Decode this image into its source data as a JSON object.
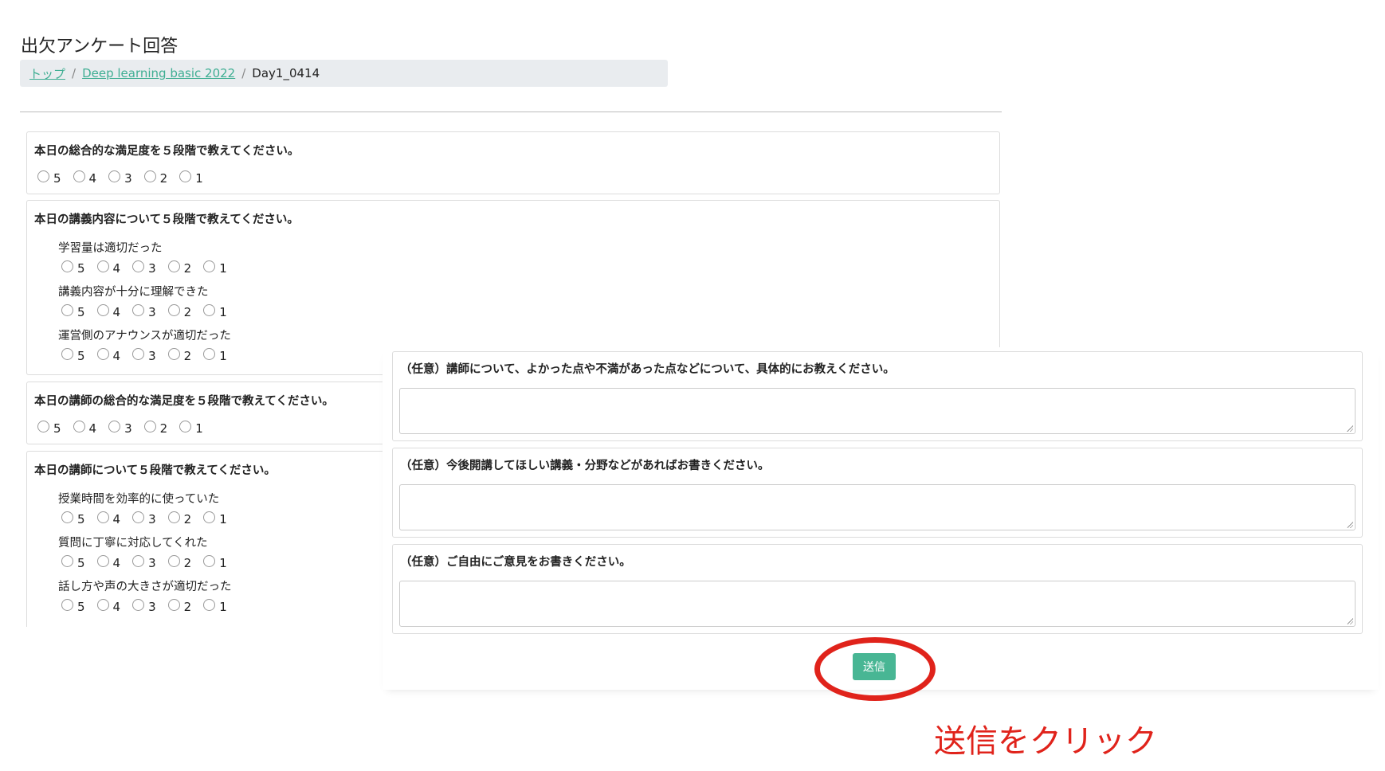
{
  "page": {
    "title": "出欠アンケート回答"
  },
  "breadcrumb": {
    "home": "トップ",
    "course": "Deep learning basic 2022",
    "current": "Day1_0414",
    "separator": "/"
  },
  "scale": [
    "5",
    "4",
    "3",
    "2",
    "1"
  ],
  "questions": {
    "q1": {
      "title": "本日の総合的な満足度を５段階で教えてください。"
    },
    "q2": {
      "title": "本日の講義内容について５段階で教えてください。",
      "items": [
        "学習量は適切だった",
        "講義内容が十分に理解できた",
        "運営側のアナウンスが適切だった"
      ]
    },
    "q3": {
      "title": "本日の講師の総合的な満足度を５段階で教えてください。"
    },
    "q4": {
      "title": "本日の講師について５段階で教えてください。",
      "items": [
        "授業時間を効率的に使っていた",
        "質問に丁寧に対応してくれた",
        "話し方や声の大きさが適切だった"
      ]
    }
  },
  "free": {
    "q5": {
      "title": "（任意）講師について、よかった点や不満があった点などについて、具体的にお教えください。",
      "value": ""
    },
    "q6": {
      "title": "（任意）今後開講してほしい講義・分野などがあればお書きください。",
      "value": ""
    },
    "q7": {
      "title": "（任意）ご自由にご意見をお書きください。",
      "value": ""
    }
  },
  "submit": {
    "label": "送信"
  },
  "annotation": {
    "text": "送信をクリック",
    "color": "#e0231b"
  },
  "colors": {
    "accent": "#48b694",
    "link": "#3fae93"
  }
}
